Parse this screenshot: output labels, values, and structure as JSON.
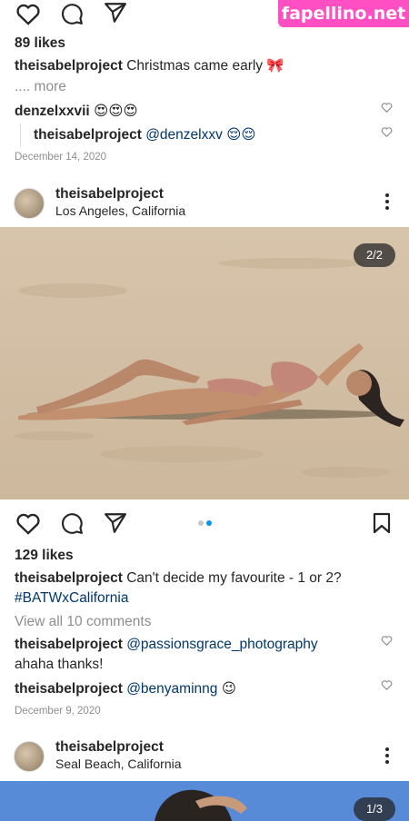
{
  "watermark": "fapellino.net",
  "post1": {
    "likes": "89 likes",
    "caption_user": "theisabelproject",
    "caption_text": "Christmas came early 🎀",
    "more": ".... more",
    "comments": [
      {
        "user": "denzelxxvii",
        "text": "😍😍😍"
      },
      {
        "user": "theisabelproject",
        "text": "@denzelxxv 😌😌"
      }
    ],
    "date": "December 14, 2020"
  },
  "post2": {
    "username": "theisabelproject",
    "location": "Los Angeles, California",
    "counter": "2/2",
    "likes": "129 likes",
    "caption_user": "theisabelproject",
    "caption_text": "Can't decide my favourite - 1 or 2?",
    "hashtag": "#BATWxCalifornia",
    "view_all": "View all 10 comments",
    "comments": [
      {
        "user": "theisabelproject",
        "mention": "@passionsgrace_photography",
        "text": "ahaha thanks!"
      },
      {
        "user": "theisabelproject",
        "mention": "@benyaminng",
        "text": "😉"
      }
    ],
    "date": "December 9, 2020"
  },
  "post3": {
    "username": "theisabelproject",
    "location": "Seal Beach, California",
    "counter": "1/3"
  },
  "colors": {
    "accent": "#0095f6",
    "link": "#00376b",
    "watermark": "#ff4fc3"
  }
}
